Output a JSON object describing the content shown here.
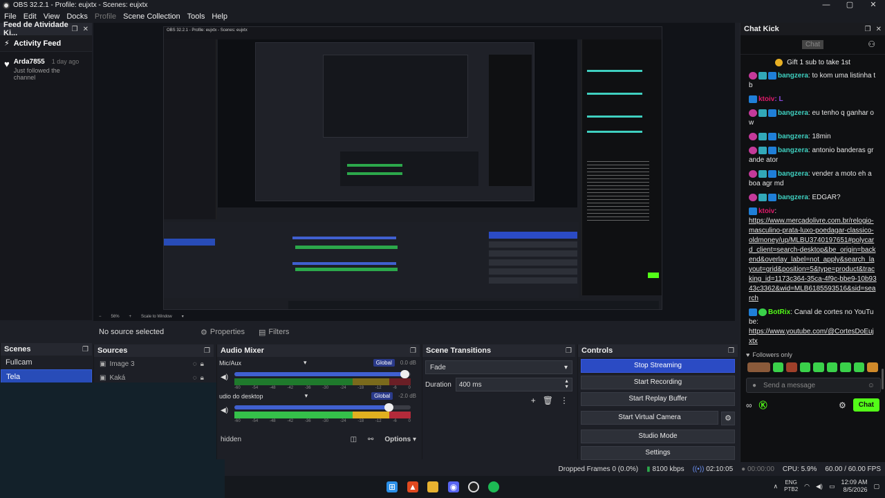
{
  "window": {
    "title": "OBS 32.2.1 - Profile: eujxtx - Scenes: eujxtx",
    "controls": [
      "—",
      "▢",
      "✕"
    ]
  },
  "menu": [
    "File",
    "Edit",
    "View",
    "Docks",
    "Profile",
    "Scene Collection",
    "Tools",
    "Help"
  ],
  "activity": {
    "dock_title": "Feed de Atividade Ki...",
    "header": "Activity Feed",
    "items": [
      {
        "user": "Arda7855",
        "ago": "1 day ago",
        "message": "Just followed the channel"
      }
    ]
  },
  "preview": {
    "nested_title": "OBS 32.2.1 - Profile: eujxtx - Scenes: eujxtx",
    "zoom_label": "56%",
    "scale_mode": "Scale to Window"
  },
  "source_bar": {
    "label": "No source selected",
    "properties": "Properties",
    "filters": "Filters"
  },
  "scenes": {
    "title": "Scenes",
    "items": [
      "Fullcam",
      "Tela"
    ],
    "selected": "Tela"
  },
  "sources": {
    "title": "Sources",
    "items": [
      "Image 3",
      "Kaká"
    ]
  },
  "mixer": {
    "title": "Audio Mixer",
    "channels": [
      {
        "name": "Mic/Aux",
        "badge": "Global",
        "db": "0.0 dB",
        "level": 0.97
      },
      {
        "name": "udio do desktop",
        "badge": "Global",
        "db": "-2.0 dB",
        "level": 0.88
      }
    ],
    "scale": [
      "-60",
      "-54",
      "-48",
      "-42",
      "-36",
      "-30",
      "-24",
      "-18",
      "-12",
      "-6",
      "0"
    ],
    "footer_hidden": "hidden",
    "options": "Options"
  },
  "transitions": {
    "title": "Scene Transitions",
    "selected": "Fade",
    "duration_label": "Duration",
    "duration_value": "400 ms"
  },
  "controls": {
    "title": "Controls",
    "stop_streaming": "Stop Streaming",
    "start_recording": "Start Recording",
    "start_replay": "Start Replay Buffer",
    "start_vcam": "Start Virtual Camera",
    "studio_mode": "Studio Mode",
    "settings": "Settings"
  },
  "status": {
    "dropped": "Dropped Frames 0 (0.0%)",
    "bitrate": "8100 kbps",
    "stream_time": "02:10:05",
    "rec_time": "00:00:00",
    "cpu": "CPU: 5.9%",
    "fps": "60.00 / 60.00 FPS"
  },
  "tray": {
    "lang1": "ENG",
    "lang2": "PTB2",
    "time": "12:09 AM",
    "date": "8/5/2026"
  },
  "chat": {
    "dock_title": "Chat Kick",
    "tab": "Chat",
    "pinned": "Gift 1 sub to take 1st",
    "messages": [
      {
        "user": "bangzera",
        "color": "#3fd0c0",
        "text": ": to kom uma listinha tb"
      },
      {
        "user": "ktoiv",
        "color": "#e01a6a",
        "text": ": L"
      },
      {
        "user": "bangzera",
        "color": "#3fd0c0",
        "text": ": eu tenho q ganhar o w"
      },
      {
        "user": "bangzera",
        "color": "#3fd0c0",
        "text": ": 18min"
      },
      {
        "user": "bangzera",
        "color": "#3fd0c0",
        "text": ": antonio banderas grande ator"
      },
      {
        "user": "bangzera",
        "color": "#3fd0c0",
        "text": ": vender a moto eh a boa agr md"
      },
      {
        "user": "bangzera",
        "color": "#3fd0c0",
        "text": ": EDGAR?"
      }
    ],
    "link_msg": {
      "user": "ktoiv",
      "link": "https://www.mercadolivre.com.br/relogio-masculino-prata-luxo-poedagar-classico-oldmoney/up/MLBU3740197651#polycard_client=search-desktop&be_origin=backend&overlay_label=not_apply&search_layout=grid&position=5&type=product&tracking_id=1173c364-35ca-4f9c-bbe9-10b9343c3362&wid=MLB6185593516&sid=search"
    },
    "bot_msg": {
      "user": "BotRix",
      "text": ": Canal de cortes no YouTube:",
      "link": "https://www.youtube.com/@CortesDoEujxtx"
    },
    "followers_label": "Followers only",
    "input_placeholder": "Send a message",
    "chat_button": "Chat"
  }
}
